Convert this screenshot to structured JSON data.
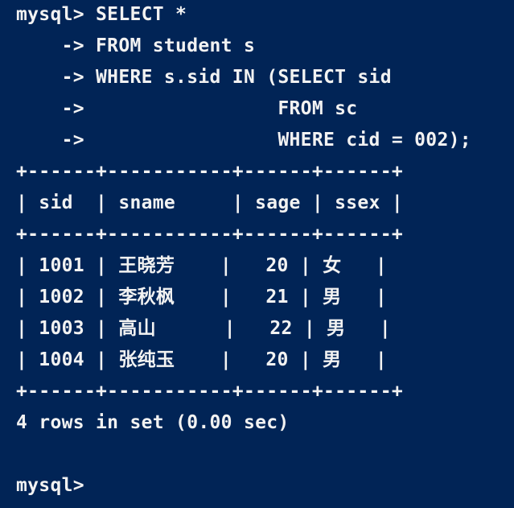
{
  "terminal": {
    "prompt": "mysql>",
    "query_lines": [
      "mysql> SELECT *",
      "    -> FROM student s",
      "    -> WHERE s.sid IN (SELECT sid",
      "    ->                 FROM sc",
      "    ->                 WHERE cid = 002);"
    ],
    "table": {
      "border_line": "+------+-----------+------+------+",
      "header_line": "| sid  | sname     | sage | ssex |",
      "columns": [
        "sid",
        "sname",
        "sage",
        "ssex"
      ],
      "rows": [
        {
          "sid": "1001",
          "sname": "王晓芳",
          "sage": "20",
          "ssex": "女",
          "line": "| 1001 | 王晓芳    |   20 | 女   |"
        },
        {
          "sid": "1002",
          "sname": "李秋枫",
          "sage": "21",
          "ssex": "男",
          "line": "| 1002 | 李秋枫    |   21 | 男   |"
        },
        {
          "sid": "1003",
          "sname": "高山",
          "sage": "22",
          "ssex": "男",
          "line": "| 1003 | 高山      |   22 | 男   |"
        },
        {
          "sid": "1004",
          "sname": "张纯玉",
          "sage": "20",
          "ssex": "男",
          "line": "| 1004 | 张纯玉    |   20 | 男   |"
        }
      ]
    },
    "result_summary": "4 rows in set (0.00 sec)",
    "final_prompt": "mysql>",
    "colors": {
      "background": "#012456",
      "foreground": "#f2f2f2"
    }
  }
}
